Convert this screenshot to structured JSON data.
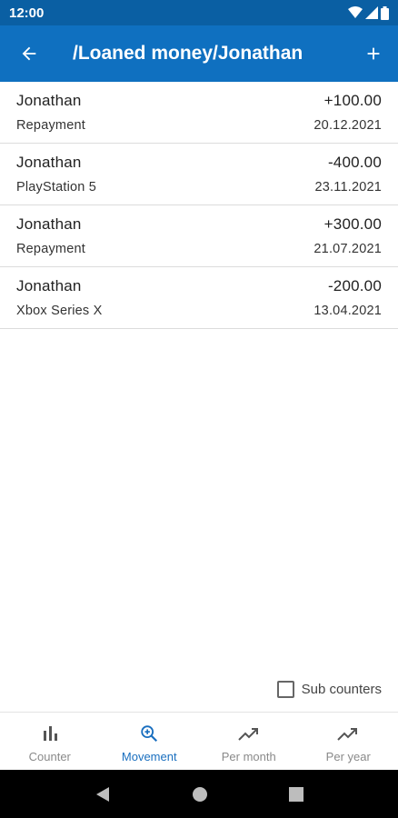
{
  "status": {
    "time": "12:00"
  },
  "appbar": {
    "title": "/Loaned money/Jonathan",
    "back_icon": "arrow-left-icon",
    "add_icon": "plus-icon"
  },
  "movements": [
    {
      "name": "Jonathan",
      "amount": "+100.00",
      "note": "Repayment",
      "date": "20.12.2021"
    },
    {
      "name": "Jonathan",
      "amount": "-400.00",
      "note": "PlayStation 5",
      "date": "23.11.2021"
    },
    {
      "name": "Jonathan",
      "amount": "+300.00",
      "note": "Repayment",
      "date": "21.07.2021"
    },
    {
      "name": "Jonathan",
      "amount": "-200.00",
      "note": "Xbox Series X",
      "date": "13.04.2021"
    }
  ],
  "sub_counters": {
    "label": "Sub counters",
    "checked": false
  },
  "bottom_nav": {
    "items": [
      {
        "label": "Counter",
        "icon": "bar-chart-icon",
        "active": false
      },
      {
        "label": "Movement",
        "icon": "zoom-in-icon",
        "active": true
      },
      {
        "label": "Per month",
        "icon": "trending-up-icon",
        "active": false
      },
      {
        "label": "Per year",
        "icon": "trending-up-icon",
        "active": false
      }
    ]
  },
  "colors": {
    "status_bar": "#0a5fa3",
    "app_bar": "#0f70c0",
    "active_nav": "#1a6fbf",
    "inactive_nav": "#8a8a8a"
  }
}
